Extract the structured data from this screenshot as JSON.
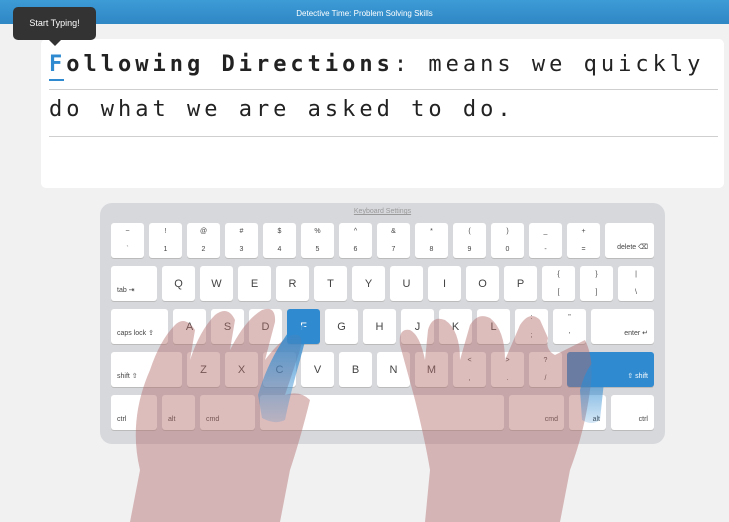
{
  "header": {
    "title": "Detective Time: Problem Solving Skills"
  },
  "tooltip": {
    "text": "Start Typing!"
  },
  "lesson": {
    "current_char": "F",
    "line1_bold_rest": "ollowing Directions",
    "line1_tail": ": means we quickly",
    "line2": "do what we are asked to do."
  },
  "keyboard": {
    "settings_label": "Keyboard Settings",
    "row1": [
      {
        "top": "~",
        "bot": "`"
      },
      {
        "top": "!",
        "bot": "1"
      },
      {
        "top": "@",
        "bot": "2"
      },
      {
        "top": "#",
        "bot": "3"
      },
      {
        "top": "$",
        "bot": "4"
      },
      {
        "top": "%",
        "bot": "5"
      },
      {
        "top": "^",
        "bot": "6"
      },
      {
        "top": "&",
        "bot": "7"
      },
      {
        "top": "*",
        "bot": "8"
      },
      {
        "top": "(",
        "bot": "9"
      },
      {
        "top": ")",
        "bot": "0"
      },
      {
        "top": "_",
        "bot": "-"
      },
      {
        "top": "+",
        "bot": "="
      }
    ],
    "delete": "delete ⌫",
    "tab": "tab ⇥",
    "row2": [
      "Q",
      "W",
      "E",
      "R",
      "T",
      "Y",
      "U",
      "I",
      "O",
      "P"
    ],
    "row2_sym": [
      {
        "top": "{",
        "bot": "["
      },
      {
        "top": "}",
        "bot": "]"
      },
      {
        "top": "|",
        "bot": "\\"
      }
    ],
    "caps": "caps lock ⇪",
    "row3": [
      "A",
      "S",
      "D",
      "F",
      "G",
      "H",
      "J",
      "K",
      "L"
    ],
    "row3_sym": [
      {
        "top": ":",
        "bot": ";"
      },
      {
        "top": "\"",
        "bot": "'"
      }
    ],
    "enter": "enter ↵",
    "shift_left": "shift ⇧",
    "row4": [
      "Z",
      "X",
      "C",
      "V",
      "B",
      "N",
      "M"
    ],
    "row4_sym": [
      {
        "top": "<",
        "bot": ","
      },
      {
        "top": ">",
        "bot": "."
      },
      {
        "top": "?",
        "bot": "/"
      }
    ],
    "shift_right": "⇧ shift",
    "ctrl": "ctrl",
    "alt": "alt",
    "cmd": "cmd",
    "highlight_key": "F",
    "highlight_color": "#2f8ad0"
  }
}
